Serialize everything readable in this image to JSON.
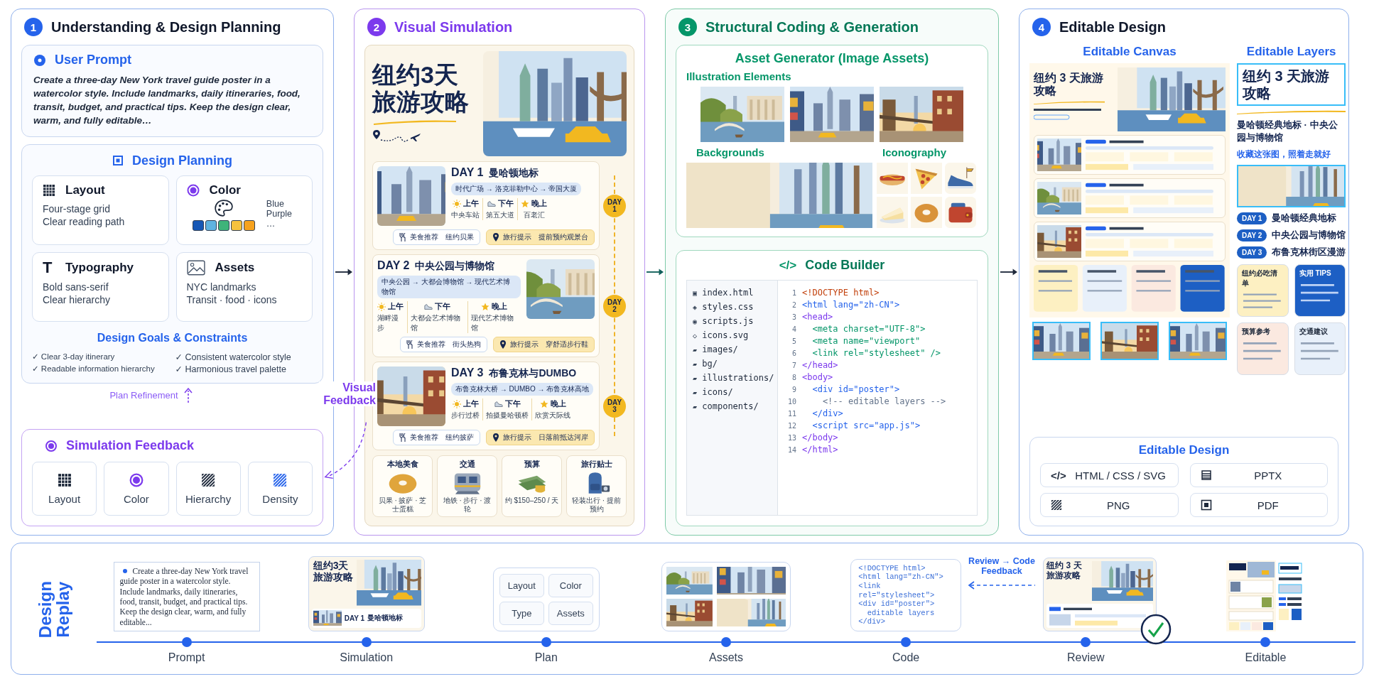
{
  "stage_1": {
    "number": "1",
    "color": "#2563eb",
    "title": "Understanding & Design Planning",
    "user_prompt": {
      "title": "User Prompt",
      "text": "Create a three-day New York travel guide poster in a watercolor style. Include landmarks, daily itineraries, food, transit, budget, and practical tips. Keep the design clear, warm, and fully editable…"
    },
    "design_planning": {
      "title": "Design Planning",
      "cards": [
        {
          "kind": "layout",
          "title": "Layout",
          "lines": [
            "Four-stage grid",
            "Clear reading path"
          ]
        },
        {
          "kind": "color",
          "title": "Color",
          "swatches": [
            {
              "color": "#1657b5"
            },
            {
              "color": "#5fb3e0"
            },
            {
              "color": "#3fb47a"
            },
            {
              "color": "#f6c23e"
            },
            {
              "color": "#f6a21e"
            }
          ],
          "lines": [
            "Blue",
            "Purple",
            "…"
          ]
        },
        {
          "kind": "typography",
          "icon": "T",
          "title": "Typography",
          "lines": [
            "Bold sans-serif",
            "Clear hierarchy"
          ]
        },
        {
          "kind": "assets",
          "title": "Assets",
          "lines": [
            "NYC landmarks",
            "Transit · food · icons"
          ]
        }
      ],
      "goals_title": "Design Goals & Constraints",
      "goals": [
        "✓ Clear 3-day itinerary",
        "✓ Readable information hierarchy",
        "✓ Consistent watercolor style",
        "✓ Harmonious travel palette"
      ]
    },
    "plan_refinement": "Plan Refinement",
    "simulation_feedback": {
      "title": "Simulation Feedback",
      "items": [
        {
          "kind": "layout",
          "label": "Layout"
        },
        {
          "kind": "color",
          "label": "Color"
        },
        {
          "kind": "hierarchy",
          "label": "Hierarchy"
        },
        {
          "kind": "density",
          "label": "Density"
        }
      ]
    }
  },
  "visual_feedback": "Visual Feedback",
  "stage_2": {
    "number": "2",
    "color": "#7c3aed",
    "title": "Visual Simulation",
    "poster": {
      "title": "纽约3天旅游攻略",
      "days": [
        {
          "day": "DAY 1",
          "title": "曼哈顿地标",
          "route": "时代广场 → 洛克菲勒中心 → 帝国大厦",
          "slots": [
            {
              "kind": "sun",
              "period": "上午",
              "place": "中央车站"
            },
            {
              "kind": "shoe",
              "period": "下午",
              "place": "第五大道"
            },
            {
              "kind": "star",
              "period": "晚上",
              "place": "百老汇"
            }
          ],
          "food": {
            "label": "美食推荐",
            "value": "纽约贝果"
          },
          "tip": {
            "label": "旅行提示",
            "value": "提前预约观景台"
          },
          "badge": "DAY 1"
        },
        {
          "day": "DAY 2",
          "title": "中央公园与博物馆",
          "route": "中央公园 → 大都会博物馆 → 现代艺术博物馆",
          "slots": [
            {
              "kind": "sun",
              "period": "上午",
              "place": "湖畔漫步"
            },
            {
              "kind": "shoe",
              "period": "下午",
              "place": "大都会艺术博物馆"
            },
            {
              "kind": "star",
              "period": "晚上",
              "place": "现代艺术博物馆"
            }
          ],
          "food": {
            "label": "美食推荐",
            "value": "街头热狗"
          },
          "tip": {
            "label": "旅行提示",
            "value": "穿舒适步行鞋"
          },
          "badge": "DAY 2"
        },
        {
          "day": "DAY 3",
          "title": "布鲁克林与DUMBO",
          "route": "布鲁克林大桥 → DUMBO → 布鲁克林高地",
          "slots": [
            {
              "kind": "sun",
              "period": "上午",
              "place": "步行过桥"
            },
            {
              "kind": "shoe",
              "period": "下午",
              "place": "拍摄曼哈顿桥"
            },
            {
              "kind": "star",
              "period": "晚上",
              "place": "欣赏天际线"
            }
          ],
          "food": {
            "label": "美食推荐",
            "value": "纽约披萨"
          },
          "tip": {
            "label": "旅行提示",
            "value": "日落前抵达河岸"
          },
          "badge": "DAY 3"
        }
      ],
      "tiles": [
        {
          "kind": "food",
          "title": "本地美食",
          "text": "贝果 · 披萨 · 芝士蛋糕"
        },
        {
          "kind": "transit",
          "title": "交通",
          "text": "地铁 · 步行 · 渡轮"
        },
        {
          "kind": "budget",
          "title": "预算",
          "text": "约 $150–250 / 天"
        },
        {
          "kind": "tips",
          "title": "旅行贴士",
          "text": "轻装出行 · 提前预约"
        }
      ]
    }
  },
  "stage_3": {
    "number": "3",
    "color": "#059669",
    "title": "Structural Coding & Generation",
    "asset_generator": {
      "title": "Asset Generator (Image Assets)",
      "illustrations_label": "Illustration Elements",
      "backgrounds_label": "Backgrounds",
      "iconography_label": "Iconography"
    },
    "code_builder": {
      "icon": "</>",
      "title": "Code Builder",
      "files": [
        {
          "icon": "▣",
          "name": "index.html"
        },
        {
          "icon": "◈",
          "name": "styles.css"
        },
        {
          "icon": "◉",
          "name": "scripts.js"
        },
        {
          "icon": "◇",
          "name": "icons.svg"
        },
        {
          "icon": "▰",
          "name": "images/"
        },
        {
          "icon": "▰",
          "name": "bg/"
        },
        {
          "icon": "▰",
          "name": "illustrations/"
        },
        {
          "icon": "▰",
          "name": "icons/"
        },
        {
          "icon": "▰",
          "name": "components/"
        }
      ],
      "lines": [
        {
          "number": "1",
          "kind": "doctype",
          "text": "<!DOCTYPE html>"
        },
        {
          "number": "2",
          "kind": "root",
          "text": "<html lang=\"zh-CN\">"
        },
        {
          "number": "3",
          "kind": "section",
          "text": "<head>"
        },
        {
          "number": "4",
          "kind": "meta",
          "text": "  <meta charset=\"UTF-8\">"
        },
        {
          "number": "5",
          "kind": "meta",
          "text": "  <meta name=\"viewport\""
        },
        {
          "number": "6",
          "kind": "meta",
          "text": "  <link rel=\"stylesheet\" />"
        },
        {
          "number": "7",
          "kind": "section",
          "text": "</head>"
        },
        {
          "number": "8",
          "kind": "section",
          "text": "<body>"
        },
        {
          "number": "9",
          "kind": "element",
          "text": "  <div id=\"poster\">"
        },
        {
          "number": "10",
          "kind": "comment",
          "text": "    <!-- editable layers -->"
        },
        {
          "number": "11",
          "kind": "element",
          "text": "  </div>"
        },
        {
          "number": "12",
          "kind": "element",
          "text": "  <script src=\"app.js\">"
        },
        {
          "number": "13",
          "kind": "section",
          "text": "</body>"
        },
        {
          "number": "14",
          "kind": "section",
          "text": "</html>"
        }
      ]
    }
  },
  "stage_4": {
    "number": "4",
    "color": "#2563eb",
    "title": "Editable Design",
    "canvas_label": "Editable Canvas",
    "layers_label": "Editable Layers",
    "canvas": {
      "title": "纽约 3 天旅游攻略"
    },
    "layers": {
      "title": "纽约 3 天旅游攻略",
      "subtitle": "曼哈顿经典地标 · 中央公园与博物馆",
      "tagline": "收藏这张图，照着走就好",
      "days": [
        {
          "badge": "DAY 1",
          "title": "曼哈顿经典地标"
        },
        {
          "badge": "DAY 2",
          "title": "中央公园与博物馆"
        },
        {
          "badge": "DAY 3",
          "title": "布鲁克林街区漫游"
        }
      ],
      "cards": [
        {
          "title": "纽约必吃清单",
          "color": "#fdf0c2"
        },
        {
          "title": "实用 TIPS",
          "color": "#1d5fc4"
        },
        {
          "title": "预算参考",
          "color": "#fbe9e0"
        },
        {
          "title": "交通建议",
          "color": "#e8f0fa"
        }
      ]
    },
    "export": {
      "title": "Editable Design",
      "formats": [
        {
          "kind": "html",
          "icon": "</>",
          "label": "HTML / CSS / SVG"
        },
        {
          "kind": "pptx",
          "label": "PPTX"
        },
        {
          "kind": "png",
          "label": "PNG"
        },
        {
          "kind": "pdf",
          "label": "PDF"
        }
      ]
    }
  },
  "design_replay": {
    "title": "Design Replay",
    "prompt_text": "Create a three-day New York travel guide poster in a watercolor style. Include landmarks, daily itineraries, food, transit, budget, and practical tips. Keep the design clear, warm, and fully editable...",
    "simulation": {
      "title": "纽约3天旅游攻略",
      "day": "DAY 1",
      "day_title": "曼哈顿地标"
    },
    "plan_chips": [
      "Layout",
      "Color",
      "Type",
      "Assets"
    ],
    "code_lines": [
      "<!DOCTYPE html>",
      "<html lang=\"zh-CN\">",
      "<link",
      "rel=\"stylesheet\">",
      "<div id=\"poster\">",
      "  editable layers",
      "</div>"
    ],
    "review_title": "纽约 3 天旅游攻略",
    "review_feedback": "Review → Code Feedback",
    "steps": [
      {
        "label": "Prompt"
      },
      {
        "label": "Simulation"
      },
      {
        "label": "Plan"
      },
      {
        "label": "Assets"
      },
      {
        "label": "Code"
      },
      {
        "label": "Review"
      },
      {
        "label": "Editable"
      }
    ]
  }
}
